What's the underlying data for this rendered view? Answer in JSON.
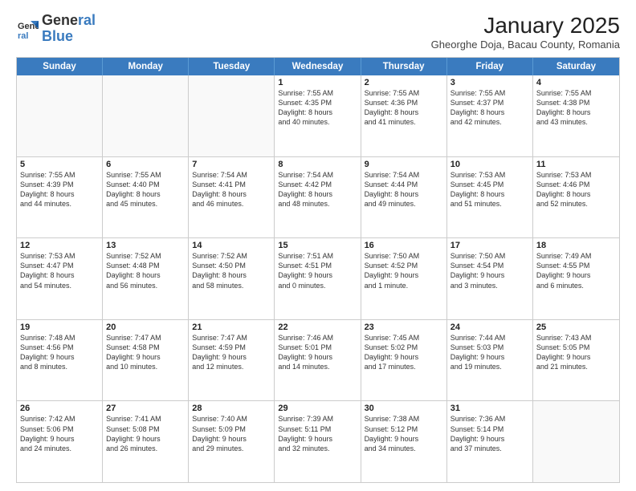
{
  "header": {
    "logo_line1": "General",
    "logo_line2": "Blue",
    "month": "January 2025",
    "location": "Gheorghe Doja, Bacau County, Romania"
  },
  "weekdays": [
    "Sunday",
    "Monday",
    "Tuesday",
    "Wednesday",
    "Thursday",
    "Friday",
    "Saturday"
  ],
  "weeks": [
    [
      {
        "day": "",
        "info": ""
      },
      {
        "day": "",
        "info": ""
      },
      {
        "day": "",
        "info": ""
      },
      {
        "day": "1",
        "info": "Sunrise: 7:55 AM\nSunset: 4:35 PM\nDaylight: 8 hours\nand 40 minutes."
      },
      {
        "day": "2",
        "info": "Sunrise: 7:55 AM\nSunset: 4:36 PM\nDaylight: 8 hours\nand 41 minutes."
      },
      {
        "day": "3",
        "info": "Sunrise: 7:55 AM\nSunset: 4:37 PM\nDaylight: 8 hours\nand 42 minutes."
      },
      {
        "day": "4",
        "info": "Sunrise: 7:55 AM\nSunset: 4:38 PM\nDaylight: 8 hours\nand 43 minutes."
      }
    ],
    [
      {
        "day": "5",
        "info": "Sunrise: 7:55 AM\nSunset: 4:39 PM\nDaylight: 8 hours\nand 44 minutes."
      },
      {
        "day": "6",
        "info": "Sunrise: 7:55 AM\nSunset: 4:40 PM\nDaylight: 8 hours\nand 45 minutes."
      },
      {
        "day": "7",
        "info": "Sunrise: 7:54 AM\nSunset: 4:41 PM\nDaylight: 8 hours\nand 46 minutes."
      },
      {
        "day": "8",
        "info": "Sunrise: 7:54 AM\nSunset: 4:42 PM\nDaylight: 8 hours\nand 48 minutes."
      },
      {
        "day": "9",
        "info": "Sunrise: 7:54 AM\nSunset: 4:44 PM\nDaylight: 8 hours\nand 49 minutes."
      },
      {
        "day": "10",
        "info": "Sunrise: 7:53 AM\nSunset: 4:45 PM\nDaylight: 8 hours\nand 51 minutes."
      },
      {
        "day": "11",
        "info": "Sunrise: 7:53 AM\nSunset: 4:46 PM\nDaylight: 8 hours\nand 52 minutes."
      }
    ],
    [
      {
        "day": "12",
        "info": "Sunrise: 7:53 AM\nSunset: 4:47 PM\nDaylight: 8 hours\nand 54 minutes."
      },
      {
        "day": "13",
        "info": "Sunrise: 7:52 AM\nSunset: 4:48 PM\nDaylight: 8 hours\nand 56 minutes."
      },
      {
        "day": "14",
        "info": "Sunrise: 7:52 AM\nSunset: 4:50 PM\nDaylight: 8 hours\nand 58 minutes."
      },
      {
        "day": "15",
        "info": "Sunrise: 7:51 AM\nSunset: 4:51 PM\nDaylight: 9 hours\nand 0 minutes."
      },
      {
        "day": "16",
        "info": "Sunrise: 7:50 AM\nSunset: 4:52 PM\nDaylight: 9 hours\nand 1 minute."
      },
      {
        "day": "17",
        "info": "Sunrise: 7:50 AM\nSunset: 4:54 PM\nDaylight: 9 hours\nand 3 minutes."
      },
      {
        "day": "18",
        "info": "Sunrise: 7:49 AM\nSunset: 4:55 PM\nDaylight: 9 hours\nand 6 minutes."
      }
    ],
    [
      {
        "day": "19",
        "info": "Sunrise: 7:48 AM\nSunset: 4:56 PM\nDaylight: 9 hours\nand 8 minutes."
      },
      {
        "day": "20",
        "info": "Sunrise: 7:47 AM\nSunset: 4:58 PM\nDaylight: 9 hours\nand 10 minutes."
      },
      {
        "day": "21",
        "info": "Sunrise: 7:47 AM\nSunset: 4:59 PM\nDaylight: 9 hours\nand 12 minutes."
      },
      {
        "day": "22",
        "info": "Sunrise: 7:46 AM\nSunset: 5:01 PM\nDaylight: 9 hours\nand 14 minutes."
      },
      {
        "day": "23",
        "info": "Sunrise: 7:45 AM\nSunset: 5:02 PM\nDaylight: 9 hours\nand 17 minutes."
      },
      {
        "day": "24",
        "info": "Sunrise: 7:44 AM\nSunset: 5:03 PM\nDaylight: 9 hours\nand 19 minutes."
      },
      {
        "day": "25",
        "info": "Sunrise: 7:43 AM\nSunset: 5:05 PM\nDaylight: 9 hours\nand 21 minutes."
      }
    ],
    [
      {
        "day": "26",
        "info": "Sunrise: 7:42 AM\nSunset: 5:06 PM\nDaylight: 9 hours\nand 24 minutes."
      },
      {
        "day": "27",
        "info": "Sunrise: 7:41 AM\nSunset: 5:08 PM\nDaylight: 9 hours\nand 26 minutes."
      },
      {
        "day": "28",
        "info": "Sunrise: 7:40 AM\nSunset: 5:09 PM\nDaylight: 9 hours\nand 29 minutes."
      },
      {
        "day": "29",
        "info": "Sunrise: 7:39 AM\nSunset: 5:11 PM\nDaylight: 9 hours\nand 32 minutes."
      },
      {
        "day": "30",
        "info": "Sunrise: 7:38 AM\nSunset: 5:12 PM\nDaylight: 9 hours\nand 34 minutes."
      },
      {
        "day": "31",
        "info": "Sunrise: 7:36 AM\nSunset: 5:14 PM\nDaylight: 9 hours\nand 37 minutes."
      },
      {
        "day": "",
        "info": ""
      }
    ]
  ]
}
